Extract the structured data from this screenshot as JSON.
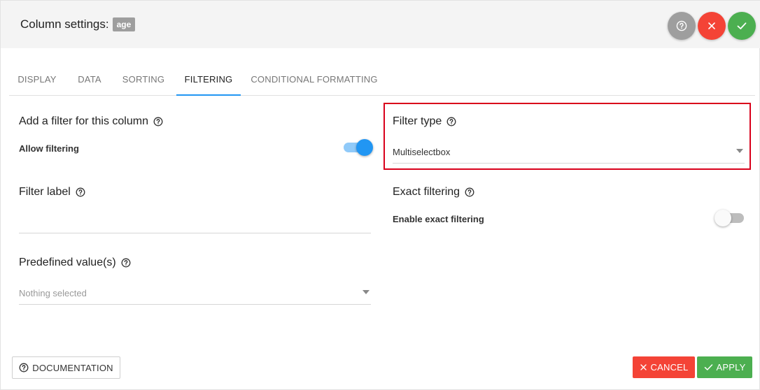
{
  "header": {
    "title": "Column settings:",
    "badge": "age",
    "icons": [
      "help-circle-icon",
      "close-icon",
      "check-icon"
    ]
  },
  "tabs": [
    {
      "label": "DISPLAY",
      "active": false
    },
    {
      "label": "DATA",
      "active": false
    },
    {
      "label": "SORTING",
      "active": false
    },
    {
      "label": "FILTERING",
      "active": true
    },
    {
      "label": "CONDITIONAL FORMATTING",
      "active": false
    }
  ],
  "left": {
    "add_filter_title": "Add a filter for this column",
    "allow_filtering_label": "Allow filtering",
    "allow_filtering_on": true,
    "filter_label_title": "Filter label",
    "filter_label_value": "",
    "predefined_title": "Predefined value(s)",
    "predefined_placeholder": "Nothing selected"
  },
  "right": {
    "filter_type_title": "Filter type",
    "filter_type_value": "Multiselectbox",
    "exact_title": "Exact filtering",
    "exact_label": "Enable exact filtering",
    "exact_on": false
  },
  "footer": {
    "documentation_label": "DOCUMENTATION",
    "cancel_label": "CANCEL",
    "apply_label": "APPLY"
  },
  "colors": {
    "accent": "#2196f3",
    "danger": "#f44336",
    "success": "#4caf50",
    "neutral": "#9e9e9e",
    "highlight": "#d9001b"
  }
}
